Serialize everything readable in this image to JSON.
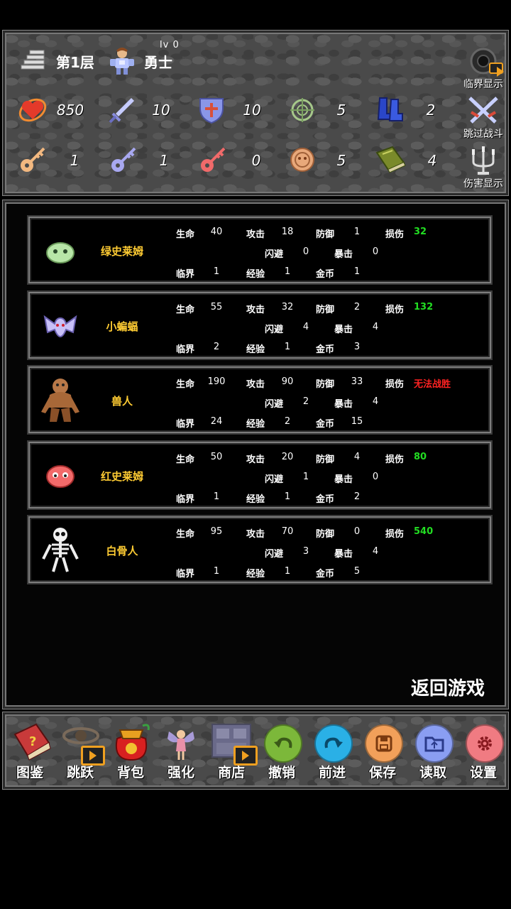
{
  "header": {
    "floor": "第1层",
    "hero_level": "lv 0",
    "hero_name": "勇士"
  },
  "stats_row1": [
    {
      "icon": "heart-orb-icon",
      "value": "850"
    },
    {
      "icon": "sword-icon",
      "value": "10"
    },
    {
      "icon": "shield-icon",
      "value": "10"
    },
    {
      "icon": "target-icon",
      "value": "5"
    },
    {
      "icon": "boots-icon",
      "value": "2"
    }
  ],
  "stats_row2": [
    {
      "icon": "yellow-key-icon",
      "value": "1"
    },
    {
      "icon": "blue-key-icon",
      "value": "1"
    },
    {
      "icon": "red-key-icon",
      "value": "0"
    },
    {
      "icon": "coin-icon",
      "value": "5"
    },
    {
      "icon": "book-icon",
      "value": "4"
    }
  ],
  "side_buttons": {
    "critical": "临界显示",
    "skip_battle": "跳过战斗",
    "damage": "伤害显示"
  },
  "stat_labels": {
    "hp": "生命",
    "atk": "攻击",
    "def": "防御",
    "dmg": "损伤",
    "dodge": "闪避",
    "crit": "暴击",
    "critical": "临界",
    "exp": "经验",
    "gold": "金币"
  },
  "monsters": [
    {
      "name": "绿史莱姆",
      "icon": "green-slime-icon",
      "hp": "40",
      "atk": "18",
      "def": "1",
      "dmg": "32",
      "dmg_color": "#22dd22",
      "dodge": "0",
      "crit": "0",
      "critical": "1",
      "exp": "1",
      "gold": "1"
    },
    {
      "name": "小蝙蝠",
      "icon": "bat-icon",
      "hp": "55",
      "atk": "32",
      "def": "2",
      "dmg": "132",
      "dmg_color": "#22dd22",
      "dodge": "4",
      "crit": "4",
      "critical": "2",
      "exp": "1",
      "gold": "3"
    },
    {
      "name": "兽人",
      "icon": "orc-icon",
      "hp": "190",
      "atk": "90",
      "def": "33",
      "dmg": "无法战胜",
      "dmg_color": "#ff2222",
      "dodge": "2",
      "crit": "4",
      "critical": "24",
      "exp": "2",
      "gold": "15"
    },
    {
      "name": "红史莱姆",
      "icon": "red-slime-icon",
      "hp": "50",
      "atk": "20",
      "def": "4",
      "dmg": "80",
      "dmg_color": "#22dd22",
      "dodge": "1",
      "crit": "0",
      "critical": "1",
      "exp": "1",
      "gold": "2"
    },
    {
      "name": "白骨人",
      "icon": "skeleton-icon",
      "hp": "95",
      "atk": "70",
      "def": "0",
      "dmg": "540",
      "dmg_color": "#22dd22",
      "dodge": "3",
      "crit": "4",
      "critical": "1",
      "exp": "1",
      "gold": "5"
    }
  ],
  "return_label": "返回游戏",
  "toolbar": [
    {
      "label": "图鉴",
      "icon": "monster-book-icon"
    },
    {
      "label": "跳跃",
      "icon": "teleport-icon"
    },
    {
      "label": "背包",
      "icon": "bag-icon"
    },
    {
      "label": "强化",
      "icon": "fairy-icon"
    },
    {
      "label": "商店",
      "icon": "shop-icon"
    },
    {
      "label": "撤销",
      "icon": "undo-icon",
      "color": "#7cb83a"
    },
    {
      "label": "前进",
      "icon": "redo-icon",
      "color": "#2ab0e6"
    },
    {
      "label": "保存",
      "icon": "save-icon",
      "color": "#f2a05a"
    },
    {
      "label": "读取",
      "icon": "load-icon",
      "color": "#8a9ef2"
    },
    {
      "label": "设置",
      "icon": "settings-icon",
      "color": "#f07b82"
    }
  ]
}
